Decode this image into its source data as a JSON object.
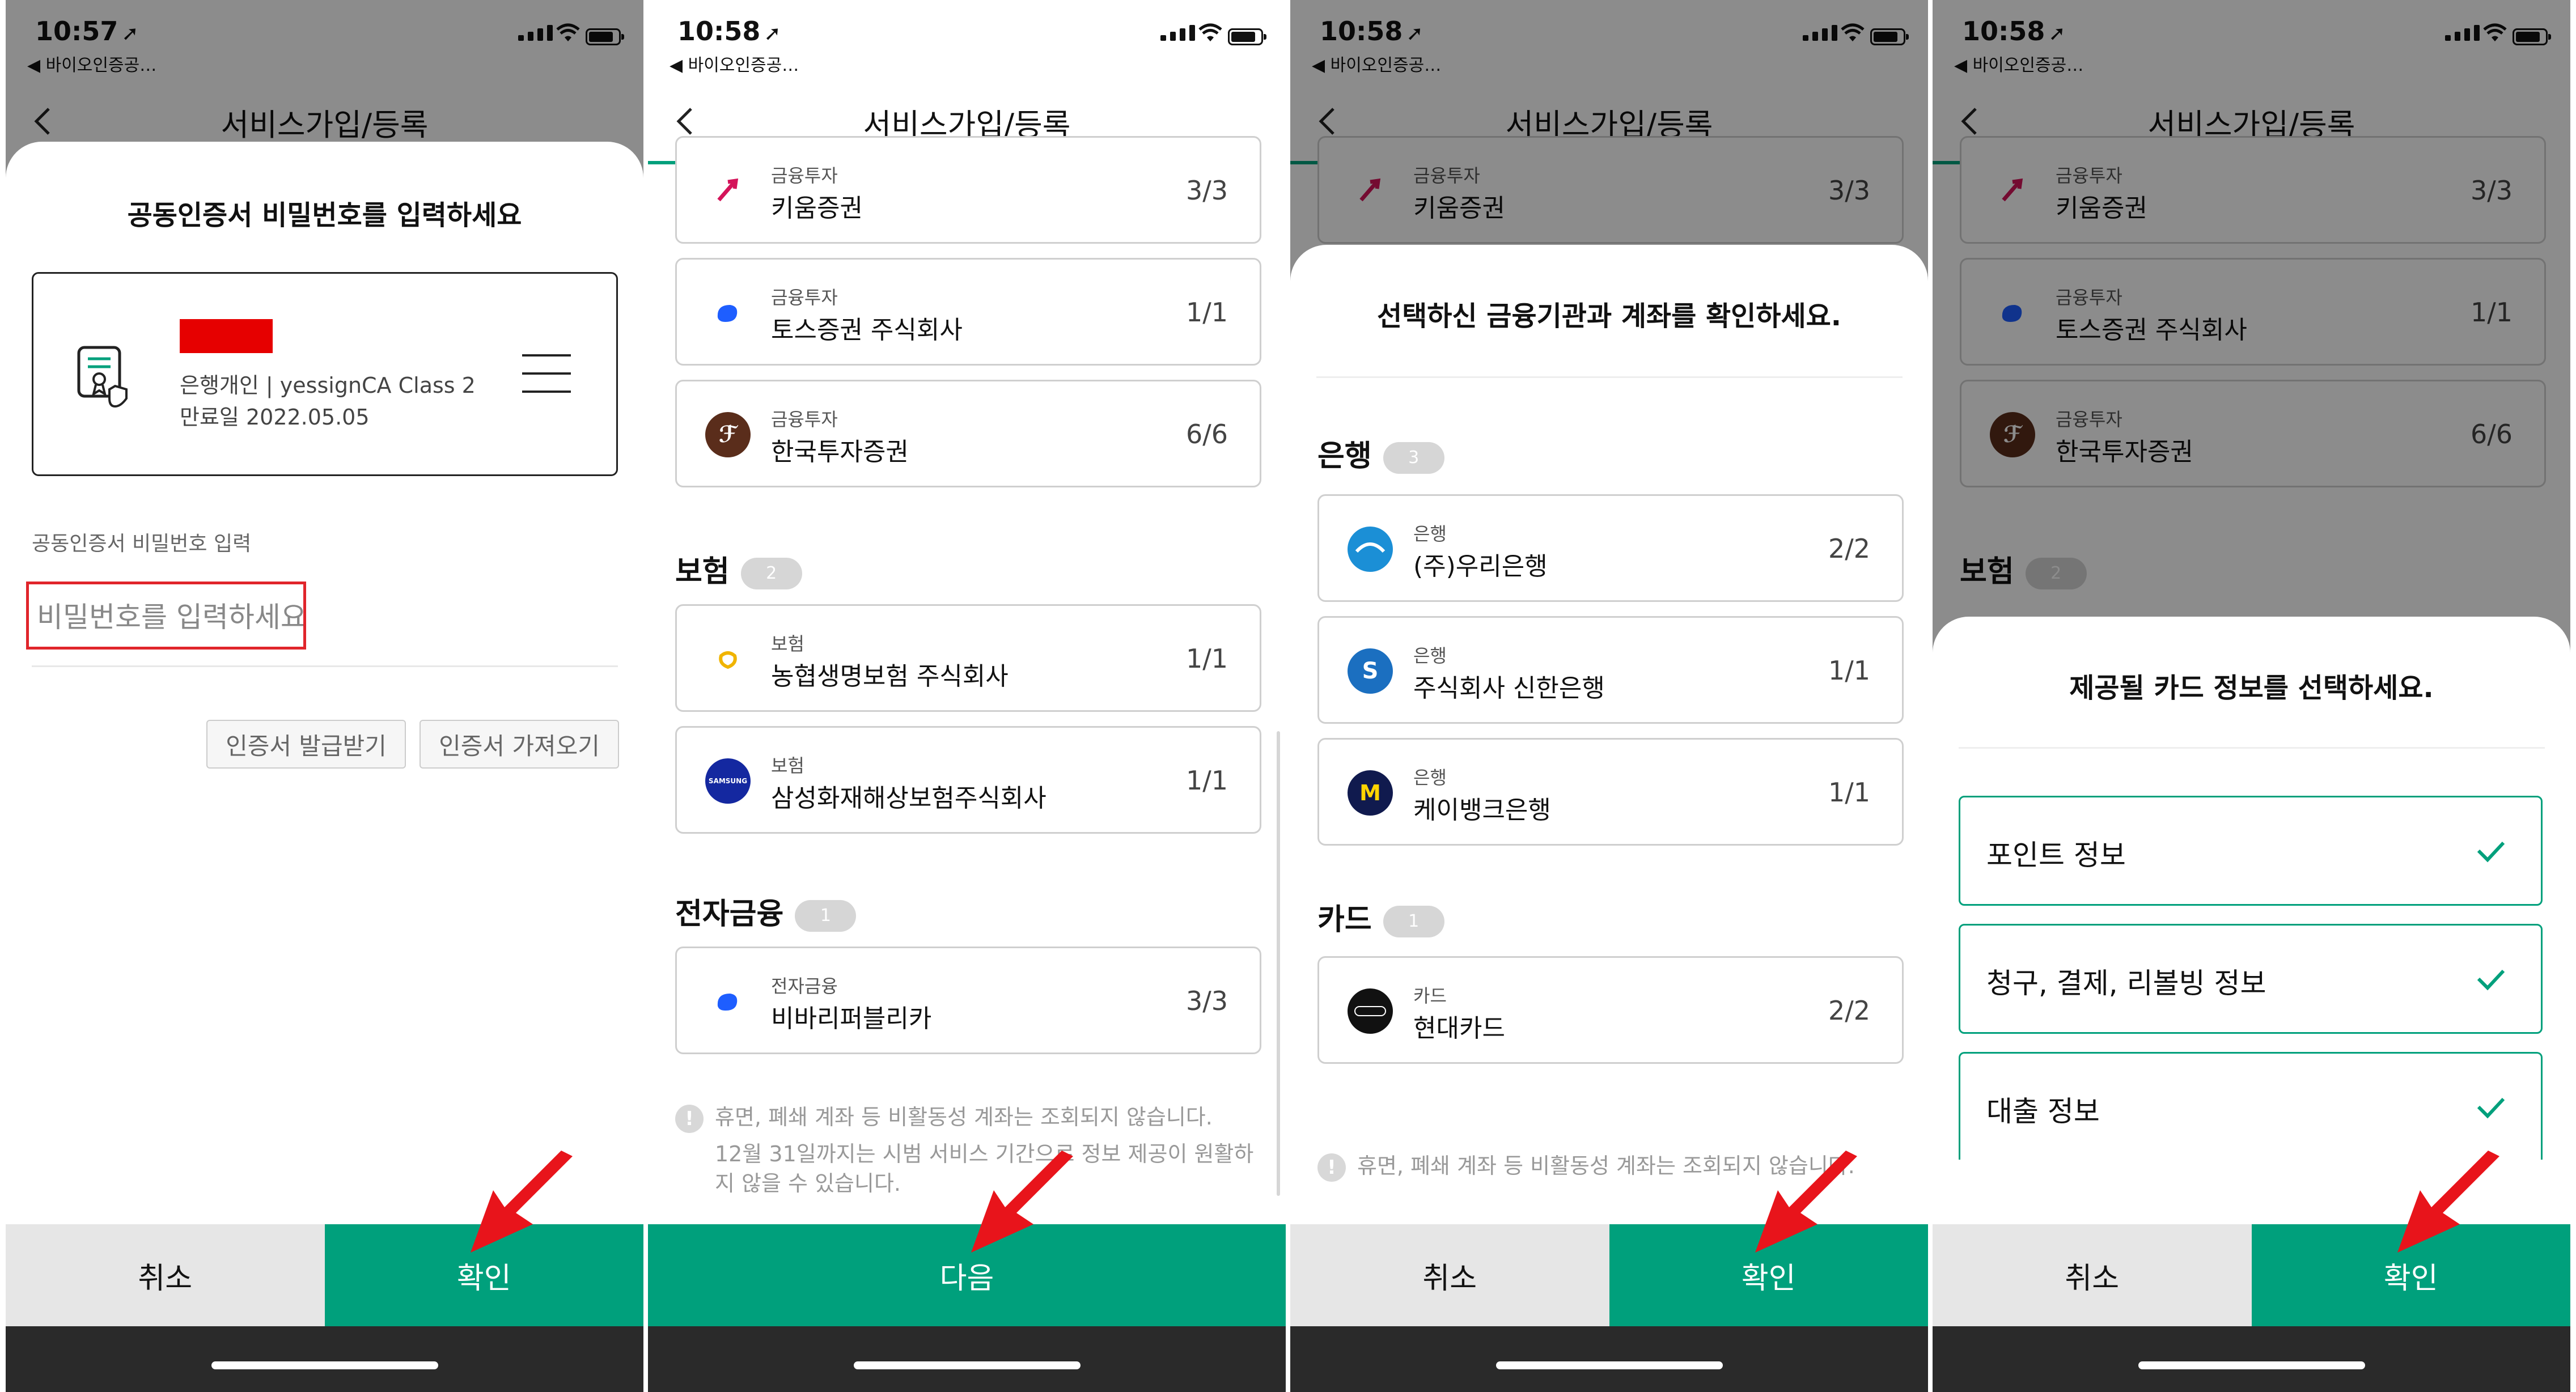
{
  "colors": {
    "accent": "#00a07c",
    "alert_red": "#e60000"
  },
  "status": {
    "time": "10:57",
    "time2": "10:58",
    "back_app": "◀ 바이오인증공…"
  },
  "nav": {
    "title": "서비스가입/등록"
  },
  "phone1": {
    "sheet_title": "공동인증서 비밀번호를 입력하세요",
    "cert_line1": "은행개인 | yessignCA Class 2",
    "cert_line2": "만료일 2022.05.05",
    "pw_label": "공동인증서 비밀번호 입력",
    "pw_placeholder": "비밀번호를 입력하세요",
    "btn_issue": "인증서 발급받기",
    "btn_import": "인증서 가져오기",
    "cancel": "취소",
    "confirm": "확인"
  },
  "securities": [
    {
      "category": "금융투자",
      "name": "키움증권",
      "count": "3/3",
      "icon": "kiwoom-logo"
    },
    {
      "category": "금융투자",
      "name": "토스증권 주식회사",
      "count": "1/1",
      "icon": "toss-logo"
    },
    {
      "category": "금융투자",
      "name": "한국투자증권",
      "count": "6/6",
      "icon": "kis-logo"
    }
  ],
  "insurance": {
    "title": "보험",
    "badge": "2",
    "items": [
      {
        "category": "보험",
        "name": "농협생명보험 주식회사",
        "count": "1/1",
        "icon": "nh-logo"
      },
      {
        "category": "보험",
        "name": "삼성화재해상보험주식회사",
        "count": "1/1",
        "icon": "samsung-logo"
      }
    ]
  },
  "efinance": {
    "title": "전자금융",
    "badge": "1",
    "items": [
      {
        "category": "전자금융",
        "name": "비바리퍼블리카",
        "count": "3/3",
        "icon": "toss-logo"
      }
    ]
  },
  "notice1": "휴면, 폐쇄 계좌 등 비활동성 계좌는 조회되지 않습니다.",
  "notice2": "12월 31일까지는 시범 서비스 기간으로 정보 제공이 원활하지 않을 수 있습니다.",
  "phone2": {
    "next": "다음"
  },
  "phone3": {
    "sheet_title": "선택하신 금융기관과 계좌를 확인하세요.",
    "bank": {
      "title": "은행",
      "badge": "3",
      "items": [
        {
          "category": "은행",
          "name": "(주)우리은행",
          "count": "2/2",
          "icon": "woori-logo"
        },
        {
          "category": "은행",
          "name": "주식회사 신한은행",
          "count": "1/1",
          "icon": "shinhan-logo"
        },
        {
          "category": "은행",
          "name": "케이뱅크은행",
          "count": "1/1",
          "icon": "kbank-logo"
        }
      ]
    },
    "card": {
      "title": "카드",
      "badge": "1",
      "items": [
        {
          "category": "카드",
          "name": "현대카드",
          "count": "2/2",
          "icon": "hyundai-card-logo"
        }
      ]
    },
    "notice": "휴면, 폐쇄 계좌 등 비활동성 계좌는 조회되지 않습니다.",
    "cancel": "취소",
    "confirm": "확인"
  },
  "phone4": {
    "sheet_title": "제공될 카드 정보를 선택하세요.",
    "options": [
      "포인트 정보",
      "청구, 결제, 리볼빙 정보",
      "대출 정보"
    ],
    "cancel": "취소",
    "confirm": "확인"
  }
}
